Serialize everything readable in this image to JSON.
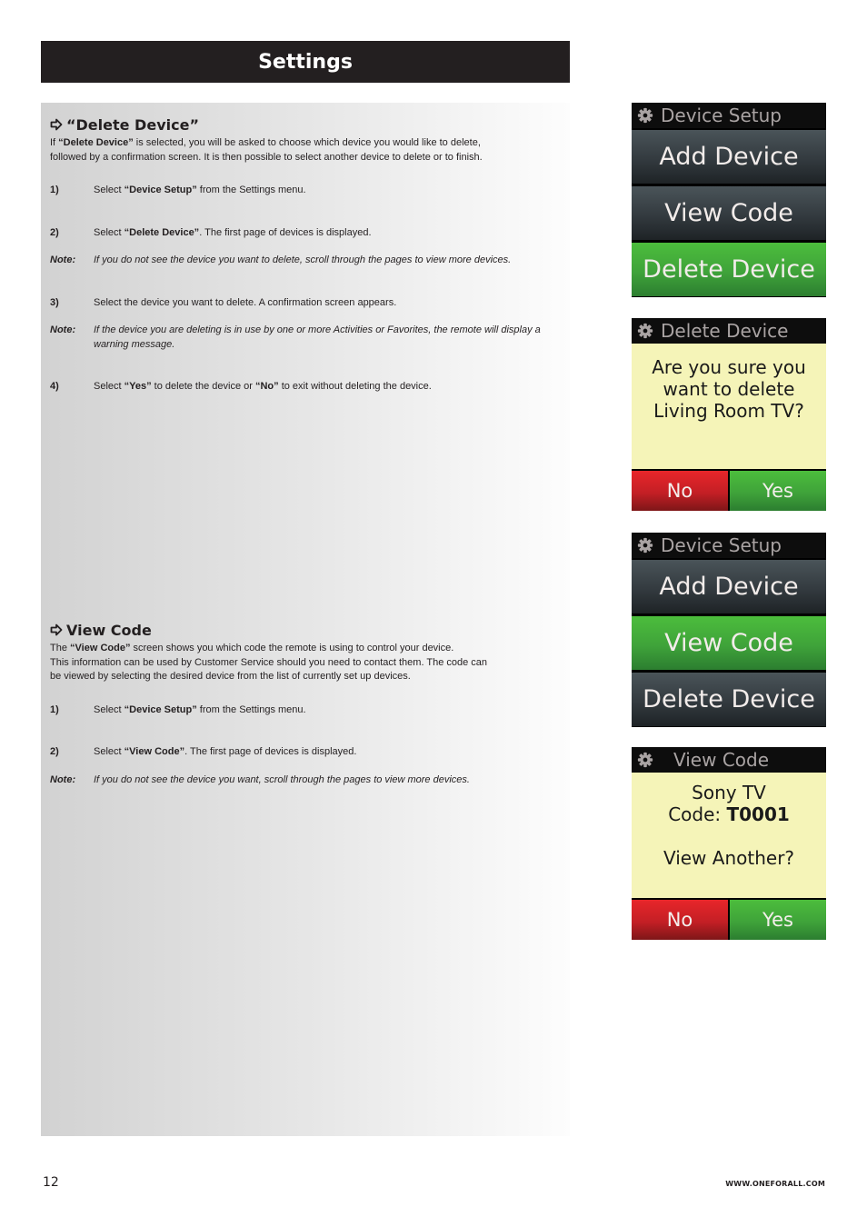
{
  "header": {
    "title": "Settings"
  },
  "delete_section": {
    "title": "“Delete Device”",
    "intro_prefix": "If ",
    "intro_bold": "“Delete Device”",
    "intro_rest_line1": " is selected, you will be asked to choose which device you would like to delete,",
    "intro_line2": "followed by a confirmation screen. It is then possible to select another device to delete or to finish.",
    "steps": [
      {
        "num": "1)",
        "pre": "Select ",
        "bold": "“Device Setup”",
        "post": " from the Settings menu."
      },
      {
        "num": "2)",
        "pre": "Select ",
        "bold": "“Delete Device”",
        "post": ". The first page of devices is displayed."
      },
      {
        "num": "Note:",
        "text": "If you do not see the device you want to delete, scroll through the pages to view more devices."
      },
      {
        "num": "3)",
        "text": "Select the device you want to delete. A confirmation screen appears."
      },
      {
        "num": "Note:",
        "text": "If the device you are deleting is in use by one or more Activities or Favorites, the remote will display a warning message."
      },
      {
        "num": "4)",
        "pre": "Select ",
        "bold": "“Yes”",
        "mid": " to delete the device or ",
        "bold2": "“No”",
        "post": " to exit without deleting the device."
      }
    ]
  },
  "view_section": {
    "title": "View Code",
    "intro_prefix": "The ",
    "intro_bold": "“View Code”",
    "intro_rest_line1": " screen shows you which code the remote is using to control your device.",
    "intro_line2": "This information can be used by Customer Service should you need to contact them. The code can",
    "intro_line3": "be viewed by selecting the desired device from the list of currently set up devices.",
    "steps": [
      {
        "num": "1)",
        "pre": "Select ",
        "bold": "“Device Setup”",
        "post": " from the Settings menu."
      },
      {
        "num": "2)",
        "pre": "Select ",
        "bold": "“View Code”",
        "post": ". The first page of devices is displayed."
      },
      {
        "num": "Note:",
        "text": "If you do not see the device you want, scroll through the pages to view more devices."
      }
    ]
  },
  "screens": {
    "device_setup_1": {
      "title": "Device Setup",
      "items": [
        "Add Device",
        "View Code",
        "Delete Device"
      ],
      "selected": "Delete Device"
    },
    "delete_confirm": {
      "title": "Delete Device",
      "lines": [
        "Are you sure you",
        "want to delete",
        "Living Room TV?"
      ],
      "no": "No",
      "yes": "Yes"
    },
    "device_setup_2": {
      "title": "Device Setup",
      "items": [
        "Add Device",
        "View Code",
        "Delete Device"
      ],
      "selected": "View Code"
    },
    "view_code": {
      "title": "View Code",
      "device": "Sony TV",
      "code_label": "Code: ",
      "code_value": "T0001",
      "question": "View Another?",
      "no": "No",
      "yes": "Yes"
    }
  },
  "footer": {
    "page_number": "12",
    "url": "WWW.ONEFORALL.COM"
  }
}
